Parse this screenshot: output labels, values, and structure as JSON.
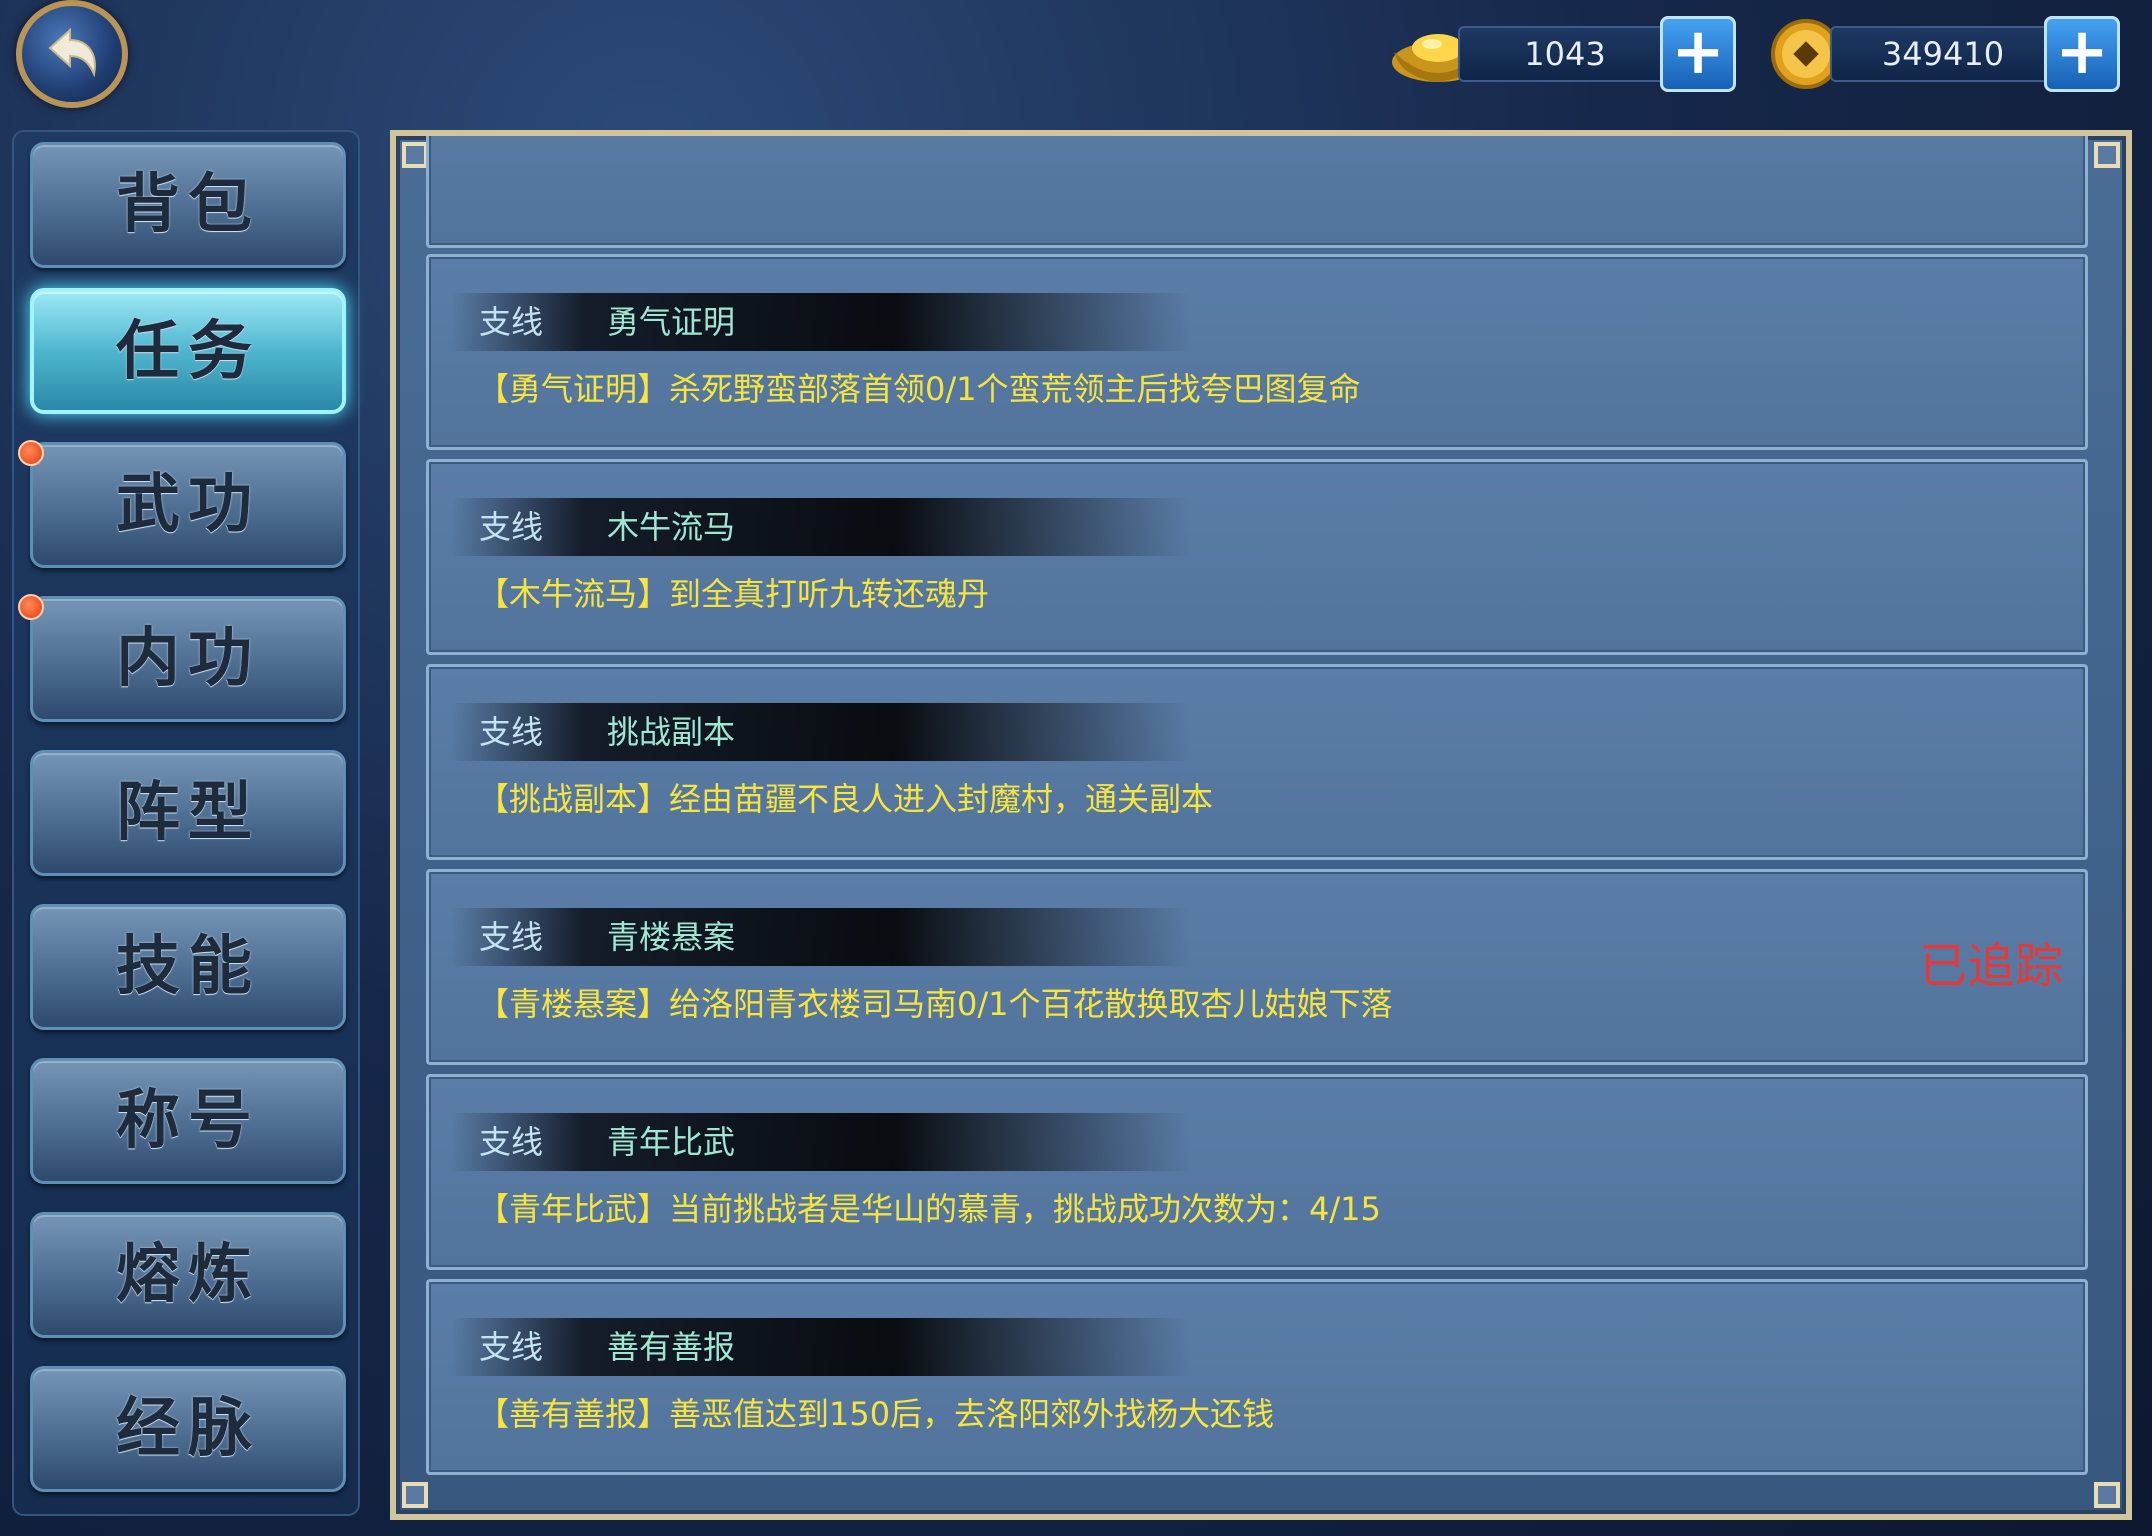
{
  "header": {
    "back_icon": "back-arrow-icon",
    "gold": {
      "icon": "gold-ingot-icon",
      "value": "1043"
    },
    "coins": {
      "icon": "copper-coin-icon",
      "value": "349410"
    },
    "plus_label": "+"
  },
  "sidebar": {
    "items": [
      {
        "label": "背包",
        "active": false,
        "badge": false
      },
      {
        "label": "任务",
        "active": true,
        "badge": false
      },
      {
        "label": "武功",
        "active": false,
        "badge": true
      },
      {
        "label": "内功",
        "active": false,
        "badge": true
      },
      {
        "label": "阵型",
        "active": false,
        "badge": false
      },
      {
        "label": "技能",
        "active": false,
        "badge": false
      },
      {
        "label": "称号",
        "active": false,
        "badge": false
      },
      {
        "label": "熔炼",
        "active": false,
        "badge": false
      },
      {
        "label": "经脉",
        "active": false,
        "badge": false
      }
    ]
  },
  "tasks": [
    {
      "type": "支线",
      "name": "勇气证明",
      "desc": "【勇气证明】杀死野蛮部落首领0/1个蛮荒领主后找夸巴图复命",
      "tracked": ""
    },
    {
      "type": "支线",
      "name": "木牛流马",
      "desc": "【木牛流马】到全真打听九转还魂丹",
      "tracked": ""
    },
    {
      "type": "支线",
      "name": "挑战副本",
      "desc": "【挑战副本】经由苗疆不良人进入封魔村，通关副本",
      "tracked": ""
    },
    {
      "type": "支线",
      "name": "青楼悬案",
      "desc": "【青楼悬案】给洛阳青衣楼司马南0/1个百花散换取杏儿姑娘下落",
      "tracked": "已追踪"
    },
    {
      "type": "支线",
      "name": "青年比武",
      "desc": "【青年比武】当前挑战者是华山的慕青，挑战成功次数为：4/15",
      "tracked": ""
    },
    {
      "type": "支线",
      "name": "善有善报",
      "desc": "【善有善报】善恶值达到150后，去洛阳郊外找杨大还钱",
      "tracked": ""
    }
  ],
  "colors": {
    "task_desc": "#f7e53e",
    "task_name": "#9fe7d2",
    "tracked": "#e23a3a",
    "panel_border": "#d2c49b"
  }
}
